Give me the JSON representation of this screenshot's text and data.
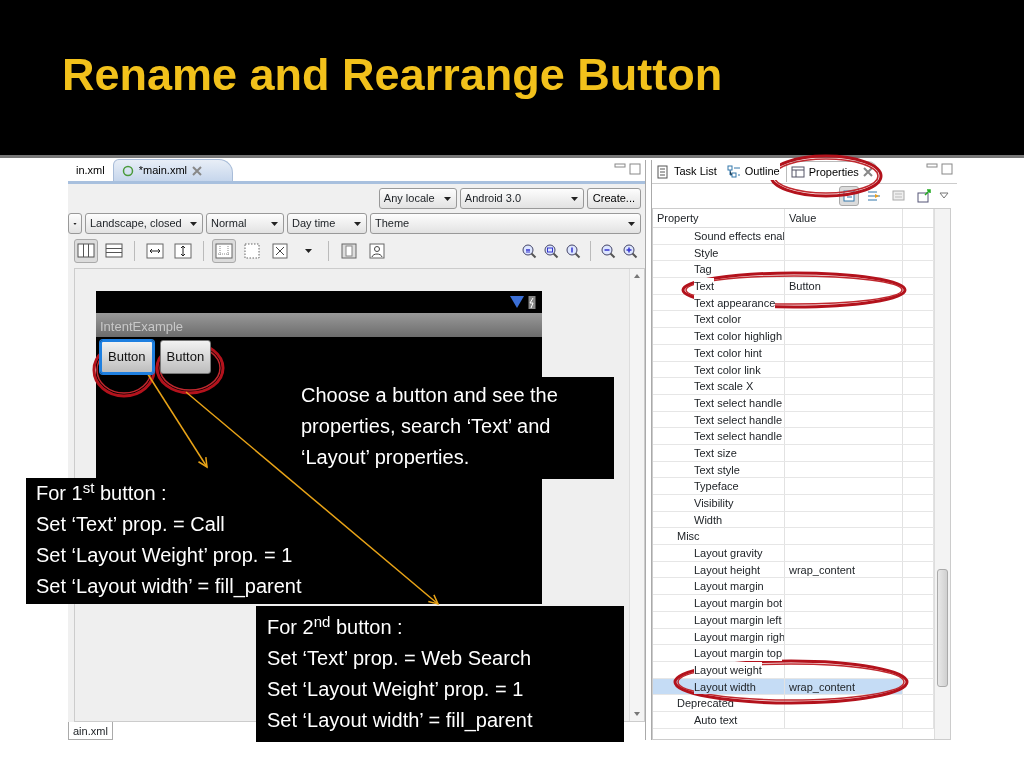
{
  "slide": {
    "title": "Rename and Rearrange Button"
  },
  "editor": {
    "tabs": [
      {
        "label": "in.xml",
        "selected": false
      },
      {
        "label": "*main.xml",
        "selected": true
      }
    ],
    "config_top": {
      "dropdowns": [
        {
          "label": "Any locale"
        },
        {
          "label": "Android 3.0"
        }
      ],
      "button": "Create..."
    },
    "config_bottom": {
      "dropdowns": [
        {
          "label": "Landscape, closed"
        },
        {
          "label": "Normal"
        },
        {
          "label": "Day time"
        },
        {
          "label": "Theme"
        }
      ]
    },
    "layout_tools": [
      {
        "kind": "columns",
        "pressed": true
      },
      {
        "kind": "rows",
        "pressed": false
      },
      {
        "kind": "separator"
      },
      {
        "kind": "width",
        "pressed": false
      },
      {
        "kind": "height",
        "pressed": false
      },
      {
        "kind": "separator"
      },
      {
        "kind": "guides",
        "pressed": true
      },
      {
        "kind": "dotted",
        "pressed": false
      },
      {
        "kind": "fit",
        "pressed": false
      },
      {
        "kind": "caret",
        "pressed": false
      },
      {
        "kind": "separator"
      },
      {
        "kind": "panel",
        "pressed": false
      },
      {
        "kind": "anchor",
        "pressed": false
      }
    ],
    "zoom_tools": [
      {
        "kind": "zoom-real"
      },
      {
        "kind": "zoom-fit"
      },
      {
        "kind": "zoom-100"
      },
      {
        "kind": "separator"
      },
      {
        "kind": "zoom-out"
      },
      {
        "kind": "zoom-in"
      }
    ],
    "device": {
      "app_title": "IntentExample",
      "buttons": [
        {
          "label": "Button",
          "selected": true
        },
        {
          "label": "Button",
          "selected": false
        }
      ]
    },
    "bottom_tab": "ain.xml"
  },
  "properties_panel": {
    "tabs": [
      {
        "label": "Task List",
        "selected": false
      },
      {
        "label": "Outline",
        "selected": false
      },
      {
        "label": "Properties",
        "selected": true
      }
    ],
    "tools": [
      {
        "kind": "categories",
        "pressed": true
      },
      {
        "kind": "advanced",
        "pressed": false
      },
      {
        "kind": "filter",
        "pressed": false
      },
      {
        "kind": "pin",
        "pressed": false
      }
    ],
    "columns": [
      "Property",
      "Value"
    ],
    "rows": [
      {
        "children": [
          {
            "property": "Sound effects enal",
            "selected": false
          },
          {
            "property": "Style",
            "selected": false
          },
          {
            "property": "Tag",
            "selected": false
          },
          {
            "property": "Text",
            "value": "Button",
            "selected": false
          },
          {
            "property": "Text appearance",
            "selected": false
          },
          {
            "property": "Text color",
            "selected": false
          },
          {
            "property": "Text color highligh",
            "selected": false
          },
          {
            "property": "Text color hint",
            "selected": false
          },
          {
            "property": "Text color link",
            "selected": false
          },
          {
            "property": "Text scale X",
            "selected": false
          },
          {
            "property": "Text select handle",
            "selected": false
          },
          {
            "property": "Text select handle",
            "selected": false
          },
          {
            "property": "Text select handle",
            "selected": false
          },
          {
            "property": "Text size",
            "selected": false
          },
          {
            "property": "Text style",
            "selected": false
          },
          {
            "property": "Typeface",
            "selected": false
          },
          {
            "property": "Visibility",
            "selected": false
          },
          {
            "property": "Width",
            "selected": false
          }
        ]
      },
      {
        "property": "Misc",
        "children": [
          {
            "property": "Layout gravity",
            "selected": false
          },
          {
            "property": "Layout height",
            "value": "wrap_content",
            "selected": false
          },
          {
            "property": "Layout margin",
            "selected": false
          },
          {
            "property": "Layout margin bot",
            "selected": false
          },
          {
            "property": "Layout margin left",
            "selected": false
          },
          {
            "property": "Layout margin righ",
            "selected": false
          },
          {
            "property": "Layout margin top",
            "selected": false
          },
          {
            "property": "Layout weight",
            "selected": false
          },
          {
            "property": "Layout width",
            "value": "wrap_content",
            "selected": true
          }
        ]
      },
      {
        "property": "Deprecated",
        "children": [
          {
            "property": "Auto text",
            "selected": false
          }
        ]
      }
    ]
  },
  "callouts": [
    {
      "kind": "paragraph",
      "text": "Choose a button and see the properties, search ‘Text’ and ‘Layout’ properties."
    },
    {
      "kind": "lines",
      "lines": [
        "For 1$^{st}$ button :",
        "Set ‘Text’ prop. = Call",
        "Set ‘Layout Weight’ prop. = 1",
        "Set ‘Layout width’  = fill_parent"
      ]
    },
    {
      "kind": "lines",
      "lines": [
        "For 2$^{nd}$  button :",
        "Set ‘Text’ prop. = Web Search",
        "Set ‘Layout Weight’ prop. = 1",
        "Set ‘Layout width’  = fill_parent"
      ]
    }
  ]
}
